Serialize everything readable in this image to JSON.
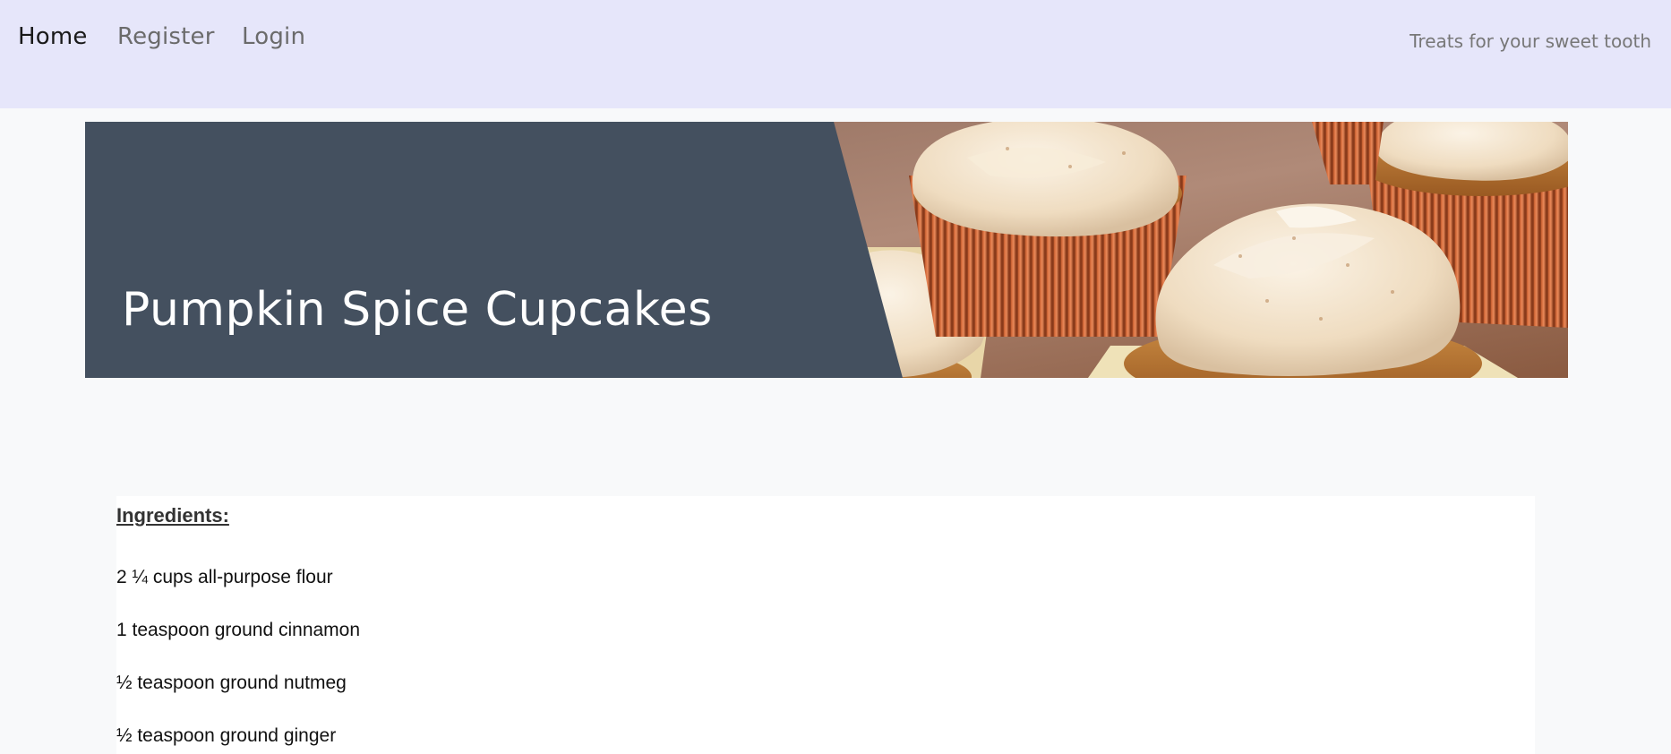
{
  "nav": {
    "links": [
      {
        "label": "Home",
        "active": true
      },
      {
        "label": "Register",
        "active": false
      },
      {
        "label": "Login",
        "active": false
      }
    ],
    "tagline": "Treats for your sweet tooth"
  },
  "hero": {
    "title": "Pumpkin Spice Cupcakes",
    "panel_color": "#44505f"
  },
  "recipe": {
    "ingredients_heading": "Ingredients:",
    "ingredients": [
      "2 ¼ cups all-purpose flour",
      "1 teaspoon ground cinnamon",
      "½ teaspoon ground nutmeg",
      "½ teaspoon ground ginger"
    ]
  },
  "colors": {
    "navbar_bg": "#e6e6fa",
    "page_bg": "#f8f9fa",
    "hero_panel": "#44505f"
  }
}
